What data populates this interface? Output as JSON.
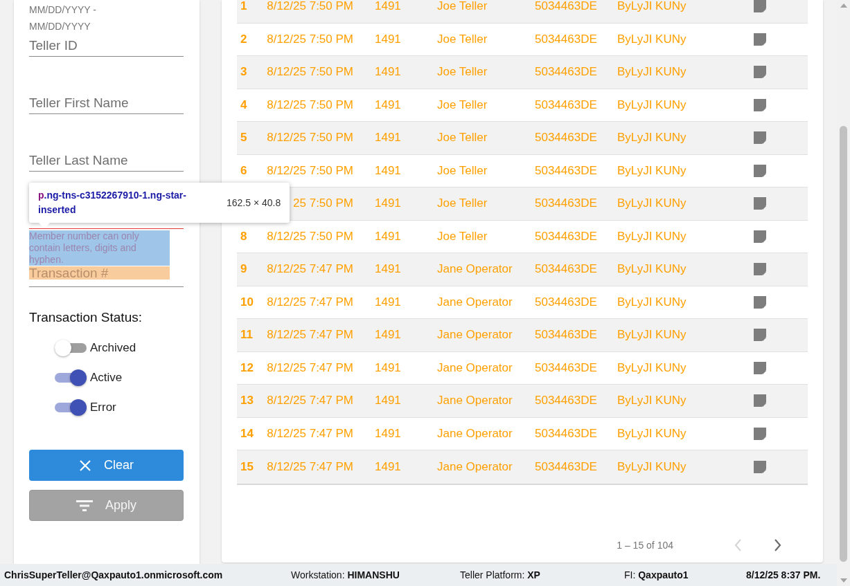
{
  "filters": {
    "date_range_placeholder": "MM/DD/YYYY - MM/DD/YYYY",
    "fields": [
      {
        "placeholder": "Teller ID",
        "invalid": false
      },
      {
        "placeholder": "Teller First Name",
        "invalid": false
      },
      {
        "placeholder": "Teller Last Name",
        "invalid": false
      },
      {
        "invalid": true,
        "error": "Member number can only contain letters, digits and hyphen."
      },
      {
        "placeholder": "Transaction #",
        "invalid": false
      }
    ],
    "status_heading": "Transaction Status:",
    "statuses": [
      {
        "label": "Archived",
        "on": false
      },
      {
        "label": "Active",
        "on": true
      },
      {
        "label": "Error",
        "on": true
      }
    ],
    "buttons": [
      {
        "kind": "clear",
        "label": "Clear",
        "disabled": false
      },
      {
        "kind": "apply",
        "label": "Apply",
        "disabled": true
      }
    ]
  },
  "inspector_tooltip": {
    "tag": "p",
    "classes": ".ng-tns-c3152267910-1.ng-star-inserted",
    "size": "162.5 × 40.8"
  },
  "table": {
    "rows": [
      {
        "number": "1",
        "cells": [
          "8/12/25 7:50 PM",
          "1491",
          "Joe Teller",
          "5034463DE",
          "ByLyJI KUNy"
        ]
      },
      {
        "number": "2",
        "cells": [
          "8/12/25 7:50 PM",
          "1491",
          "Joe Teller",
          "5034463DE",
          "ByLyJI KUNy"
        ]
      },
      {
        "number": "3",
        "cells": [
          "8/12/25 7:50 PM",
          "1491",
          "Joe Teller",
          "5034463DE",
          "ByLyJI KUNy"
        ]
      },
      {
        "number": "4",
        "cells": [
          "8/12/25 7:50 PM",
          "1491",
          "Joe Teller",
          "5034463DE",
          "ByLyJI KUNy"
        ]
      },
      {
        "number": "5",
        "cells": [
          "8/12/25 7:50 PM",
          "1491",
          "Joe Teller",
          "5034463DE",
          "ByLyJI KUNy"
        ]
      },
      {
        "number": "6",
        "cells": [
          "8/12/25 7:50 PM",
          "1491",
          "Joe Teller",
          "5034463DE",
          "ByLyJI KUNy"
        ]
      },
      {
        "cells": [
          "25 7:50 PM",
          "1491",
          "Joe Teller",
          "5034463DE",
          "ByLyJI KUNy"
        ]
      },
      {
        "number": "8",
        "cells": [
          "8/12/25 7:50 PM",
          "1491",
          "Joe Teller",
          "5034463DE",
          "ByLyJI KUNy"
        ]
      },
      {
        "number": "9",
        "cells": [
          "8/12/25 7:47 PM",
          "1491",
          "Jane Operator",
          "5034463DE",
          "ByLyJI KUNy"
        ]
      },
      {
        "number": "10",
        "cells": [
          "8/12/25 7:47 PM",
          "1491",
          "Jane Operator",
          "5034463DE",
          "ByLyJI KUNy"
        ]
      },
      {
        "number": "11",
        "cells": [
          "8/12/25 7:47 PM",
          "1491",
          "Jane Operator",
          "5034463DE",
          "ByLyJI KUNy"
        ]
      },
      {
        "number": "12",
        "cells": [
          "8/12/25 7:47 PM",
          "1491",
          "Jane Operator",
          "5034463DE",
          "ByLyJI KUNy"
        ]
      },
      {
        "number": "13",
        "cells": [
          "8/12/25 7:47 PM",
          "1491",
          "Jane Operator",
          "5034463DE",
          "ByLyJI KUNy"
        ]
      },
      {
        "number": "14",
        "cells": [
          "8/12/25 7:47 PM",
          "1491",
          "Jane Operator",
          "5034463DE",
          "ByLyJI KUNy"
        ]
      },
      {
        "number": "15",
        "cells": [
          "8/12/25 7:47 PM",
          "1491",
          "Jane Operator",
          "5034463DE",
          "ByLyJI KUNy"
        ]
      }
    ]
  },
  "pagination": {
    "range": "1 – 15 of 104",
    "previous_disabled": true,
    "next_disabled": false
  },
  "status_bar": {
    "user": "ChrisSuperTeller@Qaxpauto1.onmicrosoft.com",
    "items": [
      {
        "label": "Workstation:",
        "value": "HIMANSHU"
      },
      {
        "label": "Teller Platform:",
        "value": "XP"
      },
      {
        "label": "FI:",
        "value": "Qaxpauto1"
      }
    ],
    "datetime": "8/12/25 8:37 PM."
  }
}
